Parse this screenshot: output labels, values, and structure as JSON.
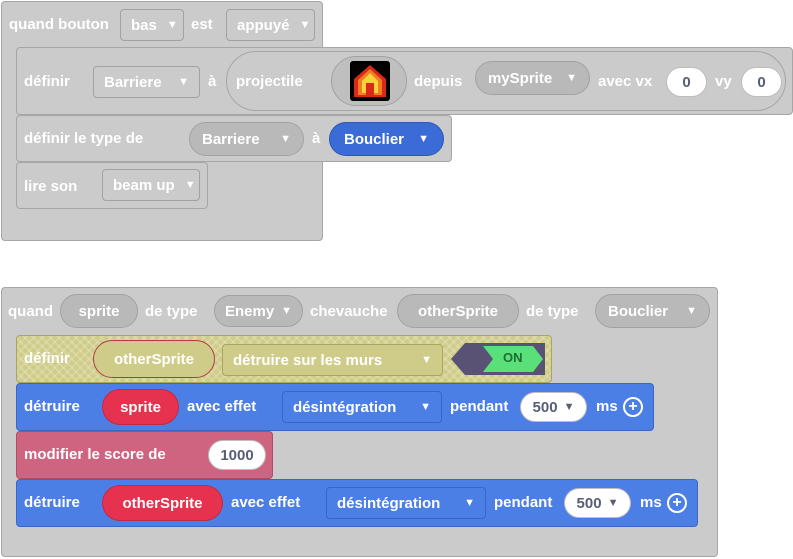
{
  "block1": {
    "hat": {
      "quand_bouton": "quand bouton",
      "button": "bas",
      "est": "est",
      "state": "appuyé"
    },
    "definir": {
      "label": "définir",
      "var": "Barriere",
      "a": "à",
      "projectile": "projectile",
      "depuis": "depuis",
      "sprite": "mySprite",
      "avec_vx": "avec vx",
      "vx": "0",
      "vy_label": "vy",
      "vy": "0"
    },
    "type": {
      "label": "définir le type de",
      "var": "Barriere",
      "a": "à",
      "kind": "Bouclier"
    },
    "sound": {
      "label": "lire son",
      "sound": "beam up"
    }
  },
  "block2": {
    "hat": {
      "quand": "quand",
      "sprite": "sprite",
      "de_type1": "de type",
      "kind1": "Enemy",
      "chevauche": "chevauche",
      "other": "otherSprite",
      "de_type2": "de type",
      "kind2": "Bouclier"
    },
    "definir": {
      "label": "définir",
      "var": "otherSprite",
      "flag": "détruire sur les murs",
      "toggle": "ON"
    },
    "destroy1": {
      "label": "détruire",
      "target": "sprite",
      "avec_effet": "avec effet",
      "effect": "désintégration",
      "pendant": "pendant",
      "ms_value": "500",
      "ms": "ms"
    },
    "score": {
      "label": "modifier le score de",
      "value": "1000"
    },
    "destroy2": {
      "label": "détruire",
      "target": "otherSprite",
      "avec_effet": "avec effet",
      "effect": "désintégration",
      "pendant": "pendant",
      "ms_value": "500",
      "ms": "ms"
    }
  },
  "icons": {
    "projectile": "house-sprite-icon",
    "dropdown": "triangle-down",
    "add": "plus-circle-icon"
  },
  "colors": {
    "event": "#cbcbcb",
    "loops_blue": "#4c7fe6",
    "score_pink": "#cf6480",
    "sprite_red": "#e6324f",
    "flag_yellow": "#cfcc89",
    "toggle_green": "#59e079"
  }
}
